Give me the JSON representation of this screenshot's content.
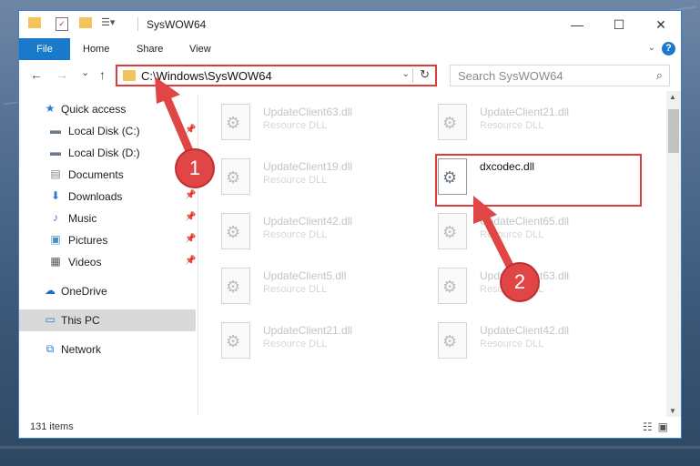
{
  "window": {
    "title": "SysWOW64",
    "minimize": "—",
    "maximize": "☐",
    "close": "✕"
  },
  "ribbon": {
    "file": "File",
    "tabs": [
      "Home",
      "Share",
      "View"
    ],
    "help": "?"
  },
  "nav": {
    "back": "←",
    "forward": "→",
    "recent": "⌄",
    "up": "↑",
    "address": "C:\\Windows\\SysWOW64",
    "refresh": "↻",
    "search_placeholder": "Search SysWOW64"
  },
  "sidebar": {
    "items": [
      {
        "label": "Quick access",
        "icon": "★",
        "pinned": false
      },
      {
        "label": "Local Disk (C:)",
        "icon": "▬",
        "pinned": true
      },
      {
        "label": "Local Disk (D:)",
        "icon": "▬",
        "pinned": false
      },
      {
        "label": "Documents",
        "icon": "▤",
        "pinned": true
      },
      {
        "label": "Downloads",
        "icon": "⬇",
        "pinned": true
      },
      {
        "label": "Music",
        "icon": "♪",
        "pinned": true
      },
      {
        "label": "Pictures",
        "icon": "▣",
        "pinned": true
      },
      {
        "label": "Videos",
        "icon": "▦",
        "pinned": true
      },
      {
        "label": "OneDrive",
        "icon": "☁",
        "pinned": false
      },
      {
        "label": "This PC",
        "icon": "▭",
        "pinned": false,
        "selected": true
      },
      {
        "label": "Network",
        "icon": "⧉",
        "pinned": false
      }
    ]
  },
  "files": [
    {
      "name": "UpdateClient63.dll",
      "type": "Resource DLL"
    },
    {
      "name": "UpdateClient21.dll",
      "type": "Resource DLL"
    },
    {
      "name": "UpdateClient19.dll",
      "type": "Resource DLL"
    },
    {
      "name": "dxcodec.dll",
      "type": "",
      "active": true
    },
    {
      "name": "UpdateClient42.dll",
      "type": "Resource DLL"
    },
    {
      "name": "UpdateClient65.dll",
      "type": "Resource DLL"
    },
    {
      "name": "UpdateClient5.dll",
      "type": "Resource DLL"
    },
    {
      "name": "UpdateClient63.dll",
      "type": "Resource DLL"
    },
    {
      "name": "UpdateClient21.dll",
      "type": "Resource DLL"
    },
    {
      "name": "UpdateClient42.dll",
      "type": "Resource DLL"
    }
  ],
  "status": {
    "item_count": "131 items"
  },
  "annotations": {
    "marker1": "1",
    "marker2": "2",
    "color": "#e04646"
  }
}
